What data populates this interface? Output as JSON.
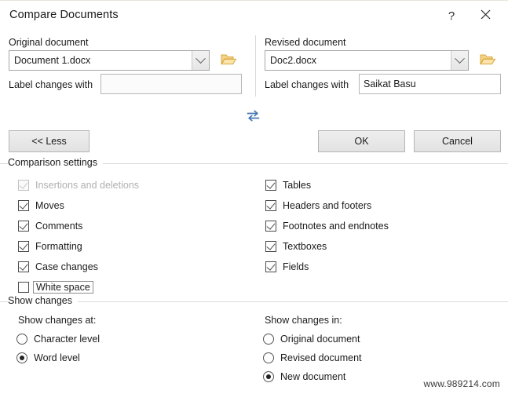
{
  "window": {
    "title": "Compare Documents",
    "help_icon": "question-mark-icon",
    "close_icon": "close-icon"
  },
  "original": {
    "section_label": "Original document",
    "document_value": "Document 1.docx",
    "label_changes_caption": "Label changes with",
    "label_changes_value": "",
    "browse_icon": "open-folder-icon",
    "dropdown_icon": "chevron-down-icon"
  },
  "revised": {
    "section_label": "Revised document",
    "document_value": "Doc2.docx",
    "label_changes_caption": "Label changes with",
    "label_changes_value": "Saikat Basu",
    "browse_icon": "open-folder-icon",
    "dropdown_icon": "chevron-down-icon"
  },
  "swap": {
    "icon": "swap-documents-icon",
    "color": "#4878b4"
  },
  "buttons": {
    "less": "<< Less",
    "ok": "OK",
    "cancel": "Cancel"
  },
  "comparison_settings": {
    "group_title": "Comparison settings",
    "left_column": [
      {
        "label": "Insertions and deletions",
        "checked": true,
        "disabled": true,
        "focused": false
      },
      {
        "label": "Moves",
        "checked": true,
        "disabled": false,
        "focused": false
      },
      {
        "label": "Comments",
        "checked": true,
        "disabled": false,
        "focused": false
      },
      {
        "label": "Formatting",
        "checked": true,
        "disabled": false,
        "focused": false
      },
      {
        "label": "Case changes",
        "checked": true,
        "disabled": false,
        "focused": false
      },
      {
        "label": "White space",
        "checked": false,
        "disabled": false,
        "focused": true
      }
    ],
    "right_column": [
      {
        "label": "Tables",
        "checked": true,
        "disabled": false,
        "focused": false
      },
      {
        "label": "Headers and footers",
        "checked": true,
        "disabled": false,
        "focused": false
      },
      {
        "label": "Footnotes and endnotes",
        "checked": true,
        "disabled": false,
        "focused": false
      },
      {
        "label": "Textboxes",
        "checked": true,
        "disabled": false,
        "focused": false
      },
      {
        "label": "Fields",
        "checked": true,
        "disabled": false,
        "focused": false
      }
    ]
  },
  "show_changes": {
    "group_title": "Show changes",
    "at": {
      "caption": "Show changes at:",
      "options": [
        {
          "label": "Character level",
          "selected": false
        },
        {
          "label": "Word level",
          "selected": true
        }
      ]
    },
    "in": {
      "caption": "Show changes in:",
      "options": [
        {
          "label": "Original document",
          "selected": false
        },
        {
          "label": "Revised document",
          "selected": false
        },
        {
          "label": "New document",
          "selected": true
        }
      ]
    }
  },
  "watermark": "www.989214.com"
}
